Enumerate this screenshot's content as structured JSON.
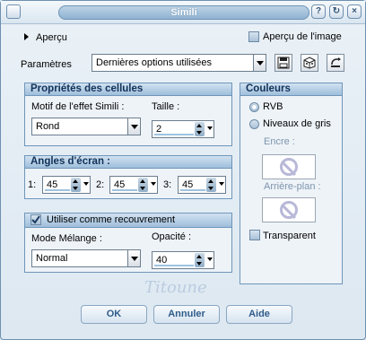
{
  "window": {
    "title": "Simili"
  },
  "preview": {
    "label": "Aperçu",
    "image_preview_label": "Aperçu de l'image"
  },
  "presets": {
    "label": "Paramètres",
    "value": "Dernières options utilisées"
  },
  "cell_props": {
    "title": "Propriétés des cellules",
    "effect_label": "Motif de l'effet Simili :",
    "effect_value": "Rond",
    "size_label": "Taille :",
    "size_value": "2"
  },
  "screen_angles": {
    "title": "Angles d'écran :",
    "a1_label": "1:",
    "a1_value": "45",
    "a2_label": "2:",
    "a2_value": "45",
    "a3_label": "3:",
    "a3_value": "45"
  },
  "overlay": {
    "checkbox_label": "Utiliser comme recouvrement",
    "blend_label": "Mode Mélange :",
    "blend_value": "Normal",
    "opacity_label": "Opacité :",
    "opacity_value": "40"
  },
  "colors": {
    "title": "Couleurs",
    "rgb_label": "RVB",
    "gray_label": "Niveaux de gris",
    "ink_label": "Encre :",
    "background_label": "Arrière-plan :",
    "transparent_label": "Transparent"
  },
  "buttons": {
    "ok": "OK",
    "cancel": "Annuler",
    "help": "Aide"
  },
  "signature": "Titoune",
  "icons": [
    "app-icon",
    "help-icon",
    "reset-icon",
    "close-icon",
    "save-preset-icon",
    "random-icon",
    "reset-preset-icon",
    "no-color-icon"
  ],
  "accent": "#9fbedb"
}
